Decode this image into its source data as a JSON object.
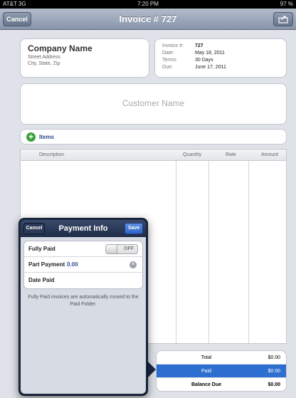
{
  "status": {
    "carrier": "AT&T 3G",
    "time": "7:20 PM",
    "battery": "97 %"
  },
  "navbar": {
    "title": "Invoice # 727",
    "cancel_label": "Cancel"
  },
  "company": {
    "name": "Company Name",
    "street": "Street Address",
    "city": "City, State, Zip"
  },
  "invoice_meta": {
    "invoice_label": "Invoice #:",
    "invoice_value": "727",
    "date_label": "Date:",
    "date_value": "May 18, 2011",
    "terms_label": "Terms:",
    "terms_value": "30 Days",
    "due_label": "Due:",
    "due_value": "June 17, 2011"
  },
  "customer": {
    "placeholder": "Customer Name"
  },
  "items": {
    "label": "Items"
  },
  "table": {
    "columns": [
      "Description",
      "Quantity",
      "Rate",
      "Amount"
    ]
  },
  "totals": {
    "total_label": "Total",
    "total_value": "$0.00",
    "paid_label": "Paid",
    "paid_value": "$0.00",
    "balance_label": "Balance Due",
    "balance_value": "$0.00"
  },
  "payment_popover": {
    "title": "Payment Info",
    "cancel_label": "Cancel",
    "save_label": "Save",
    "fully_paid_label": "Fully Paid",
    "fully_paid_state": "OFF",
    "part_payment_label": "Part Payment",
    "part_payment_value": "0.00",
    "date_paid_label": "Date Paid",
    "note": "Fully Paid invoices are automatically moved to the Paid Folder."
  }
}
